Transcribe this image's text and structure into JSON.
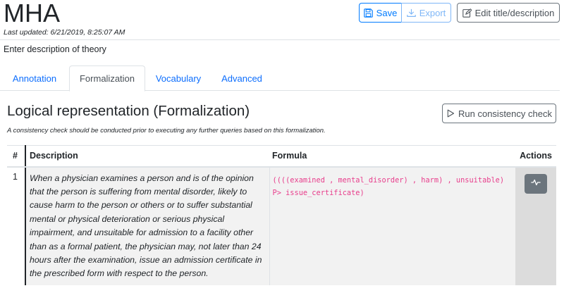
{
  "header": {
    "title": "MHA",
    "last_updated": "Last updated: 6/21/2019, 8:25:07 AM",
    "description": "Enter description of theory",
    "save_label": "Save",
    "export_label": "Export",
    "edit_label": "Edit title/description"
  },
  "tabs": [
    {
      "label": "Annotation",
      "active": false
    },
    {
      "label": "Formalization",
      "active": true
    },
    {
      "label": "Vocabulary",
      "active": false
    },
    {
      "label": "Advanced",
      "active": false
    }
  ],
  "formalization": {
    "heading": "Logical representation (Formalization)",
    "note": "A consistency check should be conducted prior to executing any further queries based on this formalization.",
    "run_label": "Run consistency check",
    "columns": {
      "num": "#",
      "description": "Description",
      "formula": "Formula",
      "actions": "Actions"
    },
    "rows": [
      {
        "num": "1",
        "description": "When a physician examines a person and is of the opinion that the person is suffering from mental disorder, likely to cause harm to the person or others or to suffer substantial mental or physical deterioration or serious physical impairment, and unsuitable for admission to a facility other than as a formal patient, the physician may, not later than 24 hours after the examination, issue an admission certificate in the prescribed form with respect to the person.",
        "formula": "((((examined , mental_disorder) , harm) , unsuitable) P> issue_certificate)"
      }
    ]
  },
  "colors": {
    "primary": "#007bff",
    "formula": "#e83e8c",
    "secondary": "#6c757d"
  },
  "icons": {
    "save": "save-icon",
    "export": "download-icon",
    "edit": "edit-icon",
    "run": "play-icon",
    "action": "activity-icon"
  }
}
